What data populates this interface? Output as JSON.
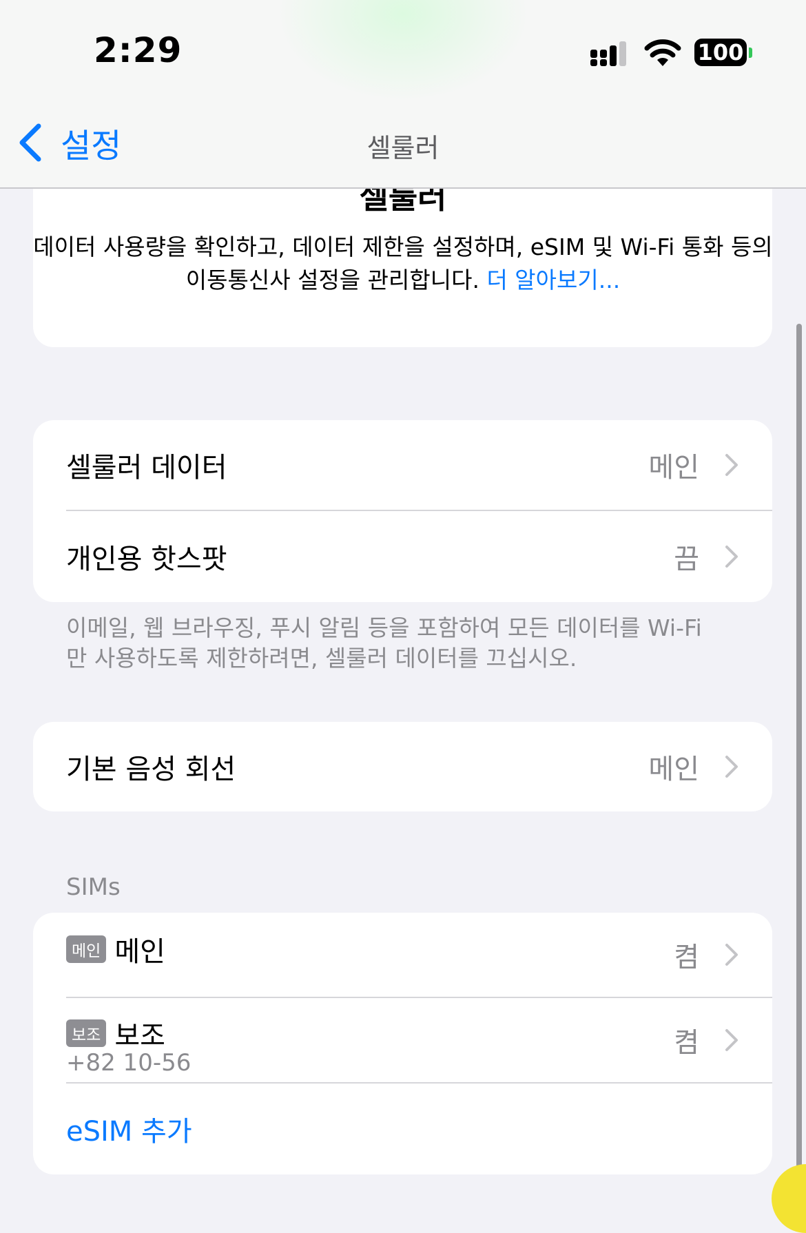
{
  "status_bar": {
    "time": "2:29",
    "battery": "100"
  },
  "nav": {
    "back_label": "설정",
    "title": "셀룰러"
  },
  "intro": {
    "title": "셀룰러",
    "text": "데이터 사용량을 확인하고, 데이터 제한을 설정하며, eSIM 및 Wi-Fi 통화 등의 이동통신사 설정을 관리합니다. ",
    "link": "더 알아보기..."
  },
  "group1": {
    "cellular_data": {
      "label": "셀룰러 데이터",
      "value": "메인"
    },
    "hotspot": {
      "label": "개인용 핫스팟",
      "value": "끔"
    }
  },
  "footnote": "이메일, 웹 브라우징, 푸시 알림 등을 포함하여 모든 데이터를 Wi-Fi만 사용하도록 제한하려면, 셀룰러 데이터를 끄십시오.",
  "group2": {
    "default_voice": {
      "label": "기본 음성 회선",
      "value": "메인"
    }
  },
  "sims": {
    "header": "SIMs",
    "items": [
      {
        "badge": "메인",
        "name": "메인",
        "number": "",
        "value": "켬"
      },
      {
        "badge": "보조",
        "name": "보조",
        "number": "+82 10-56",
        "value": "켬"
      }
    ],
    "add_label": "eSIM 추가"
  },
  "icons": {
    "back": "chevron-left-icon",
    "row": "chevron-right-icon",
    "signal": "cellular-signal-icon",
    "wifi": "wifi-icon",
    "battery": "battery-icon"
  },
  "colors": {
    "accent": "#0a7aff",
    "background": "#f2f2f7",
    "secondary_text": "#8a8a8e"
  }
}
